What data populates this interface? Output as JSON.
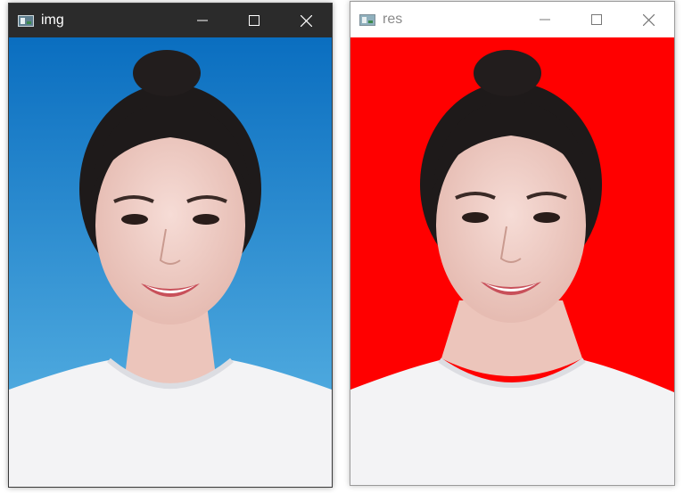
{
  "windows": [
    {
      "id": "img",
      "title": "img",
      "icon": "image-window-icon",
      "controls": [
        "minimize-icon",
        "maximize-icon",
        "close-icon"
      ],
      "content": {
        "subject": "portrait-photo",
        "background_top": "#0a6ec0",
        "background_bottom": "#5fb8e6"
      }
    },
    {
      "id": "res",
      "title": "res",
      "icon": "image-window-icon",
      "controls": [
        "minimize-icon",
        "maximize-icon",
        "close-icon"
      ],
      "content": {
        "subject": "portrait-photo",
        "background": "#ff0000"
      }
    }
  ]
}
